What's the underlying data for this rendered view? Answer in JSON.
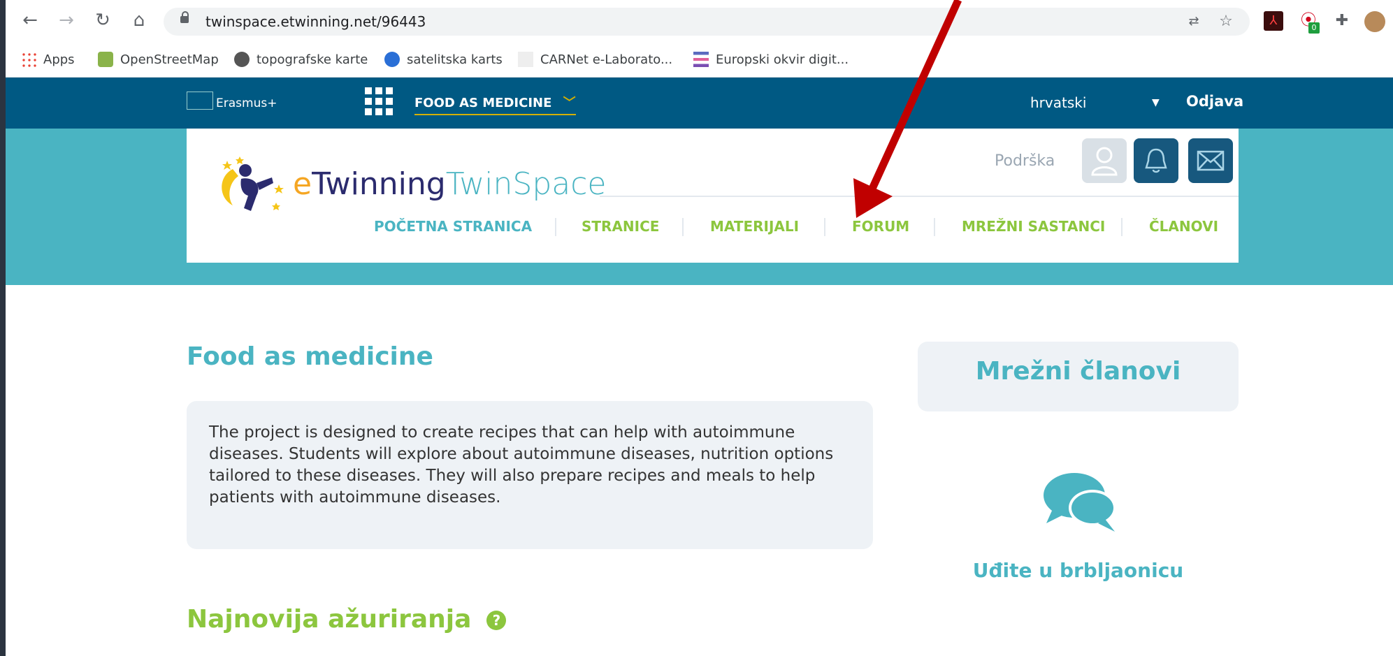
{
  "browser": {
    "url": "twinspace.etwinning.net/96443",
    "bookmarks": [
      {
        "label": "Apps",
        "icon": "apps-grid-icon"
      },
      {
        "label": "OpenStreetMap",
        "icon": "osm-icon"
      },
      {
        "label": "topografske karte",
        "icon": "globe-icon"
      },
      {
        "label": "satelitska karts",
        "icon": "earth-icon"
      },
      {
        "label": "CARNet e-Laborato...",
        "icon": "carnet-icon"
      },
      {
        "label": "Europski okvir digit...",
        "icon": "menu-lines-icon"
      }
    ],
    "extension_badge": "0"
  },
  "site": {
    "erasmus_label": "Erasmus+",
    "project_menu": "FOOD AS MEDICINE",
    "language": "hrvatski",
    "logout": "Odjava",
    "logo_e": "e",
    "logo_twinning": "Twinning",
    "logo_twinspace": "TwinSpace",
    "support": "Podrška",
    "nav": [
      "POČETNA STRANICA",
      "STRANICE",
      "MATERIJALI",
      "FORUM",
      "MREŽNI SASTANCI",
      "ČLANOVI"
    ]
  },
  "content": {
    "title": "Food as medicine",
    "description": "The project is designed to create recipes that can help with autoimmune diseases. Students will explore about autoimmune diseases, nutrition options tailored to these diseases. They will also prepare recipes and meals to help patients with autoimmune diseases.",
    "members_heading": "Mrežni članovi",
    "chat_link": "Uđite u brbljaonicu",
    "updates_heading": "Najnovija ažuriranja",
    "help_glyph": "?"
  },
  "colors": {
    "teal": "#4ab4c2",
    "green": "#8cc63e",
    "navy": "#005983",
    "arrow": "#c00000"
  }
}
